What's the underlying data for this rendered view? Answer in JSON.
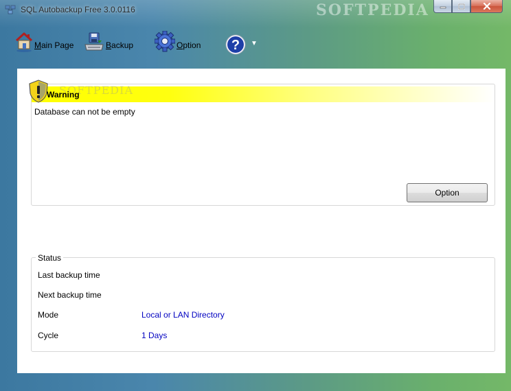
{
  "window": {
    "title": "SQL Autobackup Free 3.0.0116",
    "watermark": "SOFTPEDIA"
  },
  "toolbar": {
    "main_page": {
      "label_first": "M",
      "label_rest": "ain Page",
      "icon": "home-icon"
    },
    "backup": {
      "label_first": "B",
      "label_rest": "ackup",
      "icon": "backup-icon"
    },
    "option": {
      "label_first": "O",
      "label_rest": "ption",
      "icon": "gear-icon"
    },
    "help": {
      "icon": "help-icon",
      "dropdown_glyph": "▼"
    }
  },
  "warning": {
    "title": "Warning",
    "message": "Database can not be empty",
    "button_label": "Option",
    "watermark": "SOFTPEDIA"
  },
  "status": {
    "legend": "Status",
    "rows": [
      {
        "label": "Last backup time",
        "value": ""
      },
      {
        "label": "Next backup time",
        "value": ""
      },
      {
        "label": "Mode",
        "value": "Local or LAN Directory"
      },
      {
        "label": "Cycle",
        "value": "1 Days"
      }
    ]
  },
  "colors": {
    "accent_link": "#0000c0",
    "warning_band": "#ffff00"
  }
}
